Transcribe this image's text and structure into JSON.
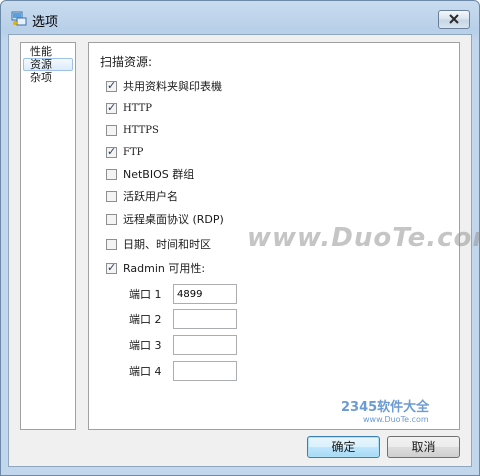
{
  "window": {
    "title": "选项",
    "icon": "options-app-icon"
  },
  "sidebar": {
    "items": [
      {
        "label": "性能",
        "selected": false
      },
      {
        "label": "资源",
        "selected": true
      },
      {
        "label": "杂项",
        "selected": false
      }
    ]
  },
  "resources": {
    "heading": "扫描资源:",
    "options": [
      {
        "label": "共用资料夹與印表機",
        "checked": true
      },
      {
        "label": "HTTP",
        "checked": true
      },
      {
        "label": "HTTPS",
        "checked": false
      },
      {
        "label": "FTP",
        "checked": true
      },
      {
        "label": "NetBIOS 群组",
        "checked": false
      },
      {
        "label": "活跃用户名",
        "checked": false
      },
      {
        "label": "远程桌面协议 (RDP)",
        "checked": false
      },
      {
        "label": "日期、时间和时区",
        "checked": false
      },
      {
        "label": "Radmin 可用性:",
        "checked": true
      }
    ],
    "ports": [
      {
        "label": "端口 1",
        "value": "4899"
      },
      {
        "label": "端口 2",
        "value": ""
      },
      {
        "label": "端口 3",
        "value": ""
      },
      {
        "label": "端口 4",
        "value": ""
      }
    ]
  },
  "buttons": {
    "ok": "确定",
    "cancel": "取消"
  },
  "watermarks": {
    "main": "www.DuoTe.com",
    "brand": "2345软件大全",
    "url": "www.DuoTe.com"
  }
}
